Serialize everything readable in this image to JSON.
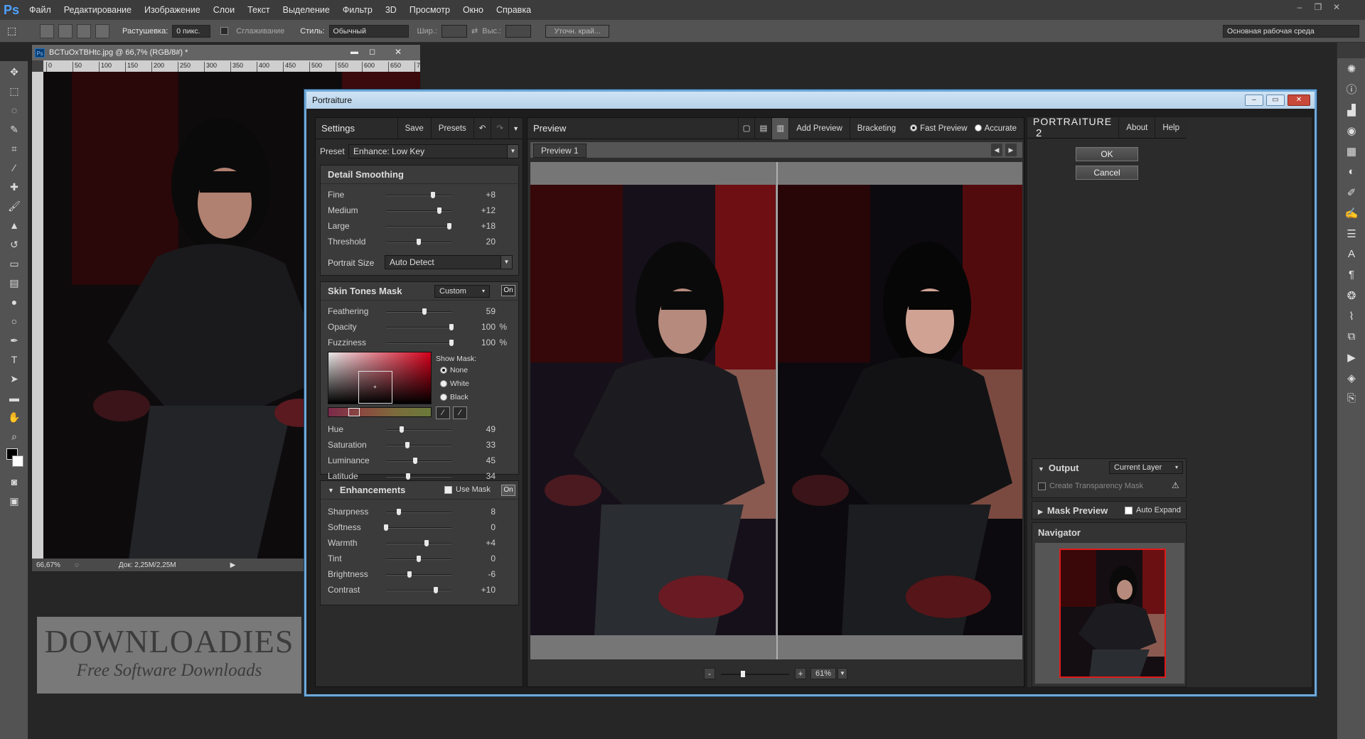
{
  "app": {
    "logo": "Ps"
  },
  "menu": [
    "Файл",
    "Редактирование",
    "Изображение",
    "Слои",
    "Текст",
    "Выделение",
    "Фильтр",
    "3D",
    "Просмотр",
    "Окно",
    "Справка"
  ],
  "options": {
    "feather_label": "Растушевка:",
    "feather_value": "0 пикс.",
    "antialias_label": "Сглаживание",
    "style_label": "Стиль:",
    "style_value": "Обычный",
    "width_label": "Шир.:",
    "height_label": "Выс.:",
    "refine_label": "Уточн. край...",
    "workspace": "Основная рабочая среда"
  },
  "document": {
    "tab_title": "BCTuOxTBHtc.jpg @ 66,7% (RGB/8#) *",
    "ruler_ticks": [
      "0",
      "50",
      "100",
      "150",
      "200",
      "250",
      "300",
      "350",
      "400",
      "450",
      "500",
      "550",
      "600",
      "650",
      "7"
    ],
    "zoom": "66,67%",
    "doc_size": "Док: 2,25M/2,25M"
  },
  "dialog": {
    "title": "Portraiture",
    "settings": {
      "title": "Settings",
      "save": "Save",
      "presets": "Presets",
      "preset_label": "Preset",
      "preset_value": "Enhance: Low Key"
    },
    "detail_smoothing": {
      "title": "Detail Smoothing",
      "sliders": [
        {
          "label": "Fine",
          "value": "+8",
          "pos": 0.72
        },
        {
          "label": "Medium",
          "value": "+12",
          "pos": 0.82
        },
        {
          "label": "Large",
          "value": "+18",
          "pos": 0.97
        },
        {
          "label": "Threshold",
          "value": "20",
          "pos": 0.5
        }
      ],
      "portrait_size_label": "Portrait Size",
      "portrait_size_value": "Auto Detect"
    },
    "skin_tones": {
      "title": "Skin Tones Mask",
      "mode": "Custom",
      "on": "On",
      "sliders": [
        {
          "label": "Feathering",
          "value": "59",
          "unit": "",
          "pos": 0.59
        },
        {
          "label": "Opacity",
          "value": "100",
          "unit": "%",
          "pos": 1.0
        },
        {
          "label": "Fuzziness",
          "value": "100",
          "unit": "%",
          "pos": 1.0
        }
      ],
      "show_mask_label": "Show Mask:",
      "mask_options": [
        "None",
        "White",
        "Black"
      ],
      "hsl_sliders": [
        {
          "label": "Hue",
          "value": "49",
          "pos": 0.24
        },
        {
          "label": "Saturation",
          "value": "33",
          "pos": 0.33
        },
        {
          "label": "Luminance",
          "value": "45",
          "pos": 0.45
        },
        {
          "label": "Latitude",
          "value": "34",
          "pos": 0.34
        }
      ]
    },
    "enhancements": {
      "title": "Enhancements",
      "use_mask": "Use Mask",
      "on": "On",
      "sliders": [
        {
          "label": "Sharpness",
          "value": "8",
          "pos": 0.2
        },
        {
          "label": "Softness",
          "value": "0",
          "pos": 0.0
        },
        {
          "label": "Warmth",
          "value": "+4",
          "pos": 0.62
        },
        {
          "label": "Tint",
          "value": "0",
          "pos": 0.5
        },
        {
          "label": "Brightness",
          "value": "-6",
          "pos": 0.36
        },
        {
          "label": "Contrast",
          "value": "+10",
          "pos": 0.76
        }
      ]
    },
    "preview": {
      "title": "Preview",
      "add_preview": "Add Preview",
      "bracketing": "Bracketing",
      "fast_preview": "Fast Preview",
      "accurate": "Accurate",
      "tab": "Preview 1",
      "zoom_minus": "-",
      "zoom_plus": "+",
      "zoom_value": "61%"
    },
    "right": {
      "brand": "PORTRAITURE",
      "brand_num": "2",
      "about": "About",
      "help": "Help",
      "ok": "OK",
      "cancel": "Cancel",
      "output_label": "Output",
      "output_value": "Current Layer",
      "transparency_mask": "Create Transparency Mask",
      "mask_preview": "Mask Preview",
      "auto_expand": "Auto Expand",
      "navigator": "Navigator"
    }
  },
  "watermark": {
    "line1": "DOWNLOADIES",
    "line2": "Free Software Downloads"
  }
}
